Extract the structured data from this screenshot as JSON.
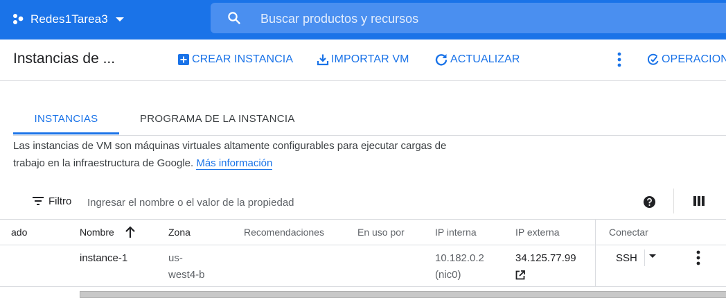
{
  "topbar": {
    "project_name": "Redes1Tarea3",
    "search_placeholder": "Buscar productos y recursos",
    "icons": [
      "project-dots-icon",
      "dropdown-arrow-icon",
      "search-icon"
    ]
  },
  "toolbar": {
    "title": "Instancias de ...",
    "create_label": "CREAR INSTANCIA",
    "import_label": "IMPORTAR VM",
    "refresh_label": "ACTUALIZAR",
    "operations_label": "OPERACIONE"
  },
  "tabs": [
    {
      "label": "INSTANCIAS",
      "active": true
    },
    {
      "label": "PROGRAMA DE LA INSTANCIA",
      "active": false
    }
  ],
  "description": {
    "text": "Las instancias de VM son máquinas virtuales altamente configurables para ejecutar cargas de trabajo en la infraestructura de Google.",
    "link": "Más información"
  },
  "filter": {
    "label": "Filtro",
    "placeholder": "Ingresar el nombre o el valor de la propiedad"
  },
  "table": {
    "headers": {
      "status": "ado",
      "name": "Nombre",
      "zone": "Zona",
      "recommendations": "Recomendaciones",
      "in_use_by": "En uso por",
      "internal_ip": "IP interna",
      "external_ip": "IP externa",
      "connect": "Conectar"
    },
    "rows": [
      {
        "name": "instance-1",
        "zone_line1": "us-",
        "zone_line2": "west4-b",
        "internal_ip": "10.182.0.2",
        "internal_nic": "(nic0)",
        "external_ip": "34.125.77.99",
        "connect": "SSH"
      }
    ]
  },
  "colors": {
    "brand_blue": "#1a73e8",
    "search_bg": "#4a8ff0",
    "border": "#dadce0",
    "muted_text": "#5f6368"
  }
}
